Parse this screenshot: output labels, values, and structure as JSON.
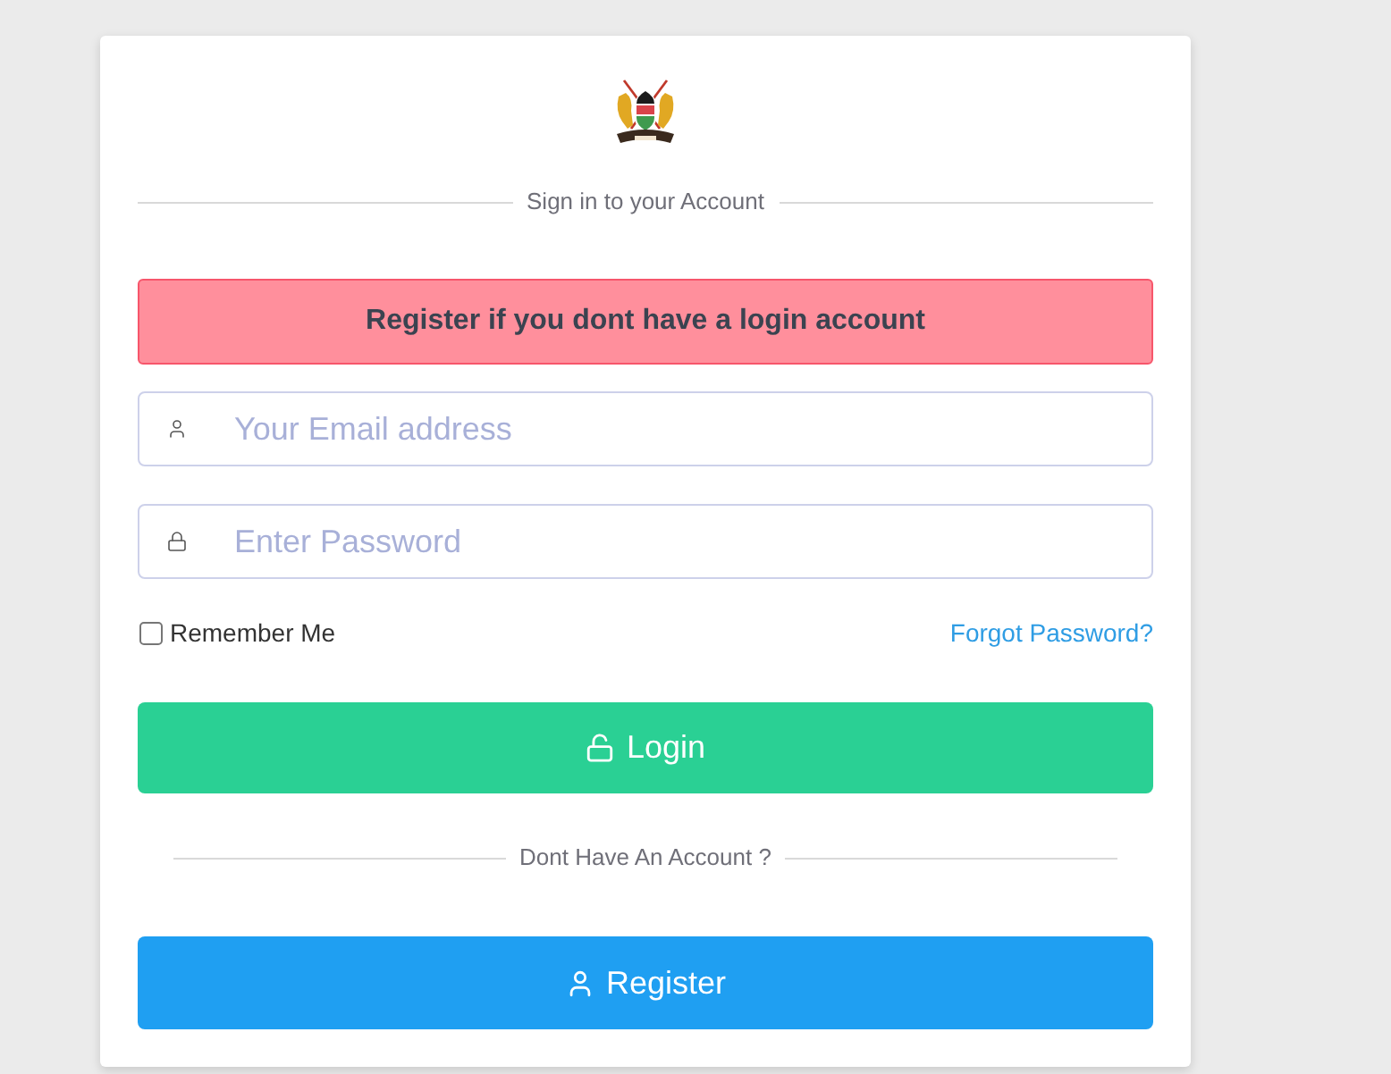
{
  "header_divider": {
    "label": "Sign in to your Account"
  },
  "alert": {
    "message": "Register if you dont have a login account"
  },
  "fields": [
    {
      "kind": "email",
      "placeholder": "Your Email address"
    },
    {
      "kind": "password",
      "placeholder": "Enter Password"
    }
  ],
  "remember": {
    "label": "Remember Me",
    "checked": false
  },
  "forgot_link": "Forgot Password?",
  "login_button": {
    "label": "Login"
  },
  "register_divider": {
    "label": "Dont Have An Account ?"
  },
  "register_button": {
    "label": "Register"
  }
}
